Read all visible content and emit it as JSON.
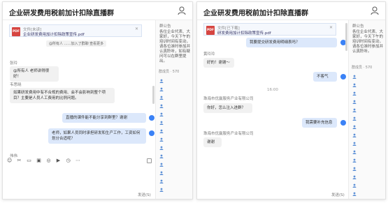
{
  "left": {
    "title": "企业研发费用税前加计扣除直播群",
    "file": {
      "title": "文件[未读]",
      "name": "企业研发费用加计扣除政策宣传.pdf"
    },
    "notice": "@所有人 ……加入了群聊 查看更多",
    "sidebar": {
      "title": "群公告",
      "text": "各位企业代表、大家好，今天下午的培训时间有变动，请各位准时参加并认真聆听，如有疑问可以在群里提出。",
      "members": "群成员 · 570"
    },
    "messages": [
      {
        "sender": "张玲",
        "text": "@所有人 老师讲得很好！",
        "me": false
      },
      {
        "sender": "韦思晓",
        "text": "如果研发费用中有不合规的费用、会不会影响到整个项目？主要是人员人工费用的比例问题。",
        "me": false
      },
      {
        "sender": "",
        "text": "直播的课件能不能分享到群里？谢谢",
        "me": true
      },
      {
        "sender": "",
        "text": "老师，如果人员同时承担研发和生产工作，工资如何划分合适呢？",
        "me": true
      }
    ],
    "input_label": "伟伟",
    "send_label": "发送(S)"
  },
  "right": {
    "title": "企业研发费用税前加计扣除直播群",
    "file": {
      "title": "文件[已下载]",
      "name": "研发费用加计扣除政策宣传.pdf"
    },
    "sidebar": {
      "title": "群公告",
      "text": "各位企业代表、大家好，今天下午的培训时间有变动，请各位准时参加并认真聆听。",
      "members": "群成员 · 570"
    },
    "messages": [
      {
        "sender": "",
        "text": "我要提交研发费用明细表吗？",
        "me": true
      },
      {
        "sender": "黄玲玲",
        "text": "好的！谢谢～",
        "me": false
      },
      {
        "sender": "",
        "text": "不客气",
        "me": true
      },
      {
        "sender": "珠海市优赢服务产业有限公司",
        "text": "你好，怎么注入进群？",
        "me": false
      },
      {
        "sender": "",
        "text": "我需要补充信息",
        "me": true
      },
      {
        "sender": "珠海市优赢服务产业有限公司",
        "text": "谢谢",
        "me": false
      }
    ],
    "timestamp": "16:00",
    "send_label": "发送(S)"
  },
  "colors": {
    "accent": "#3b82f6",
    "bubble_self": "#dce8fb",
    "bubble_other": "#f1f1f1",
    "pdf": "#d64541"
  },
  "icons": {
    "user": "user-icon",
    "pdf": "pdf-icon",
    "member": "member-icon"
  }
}
